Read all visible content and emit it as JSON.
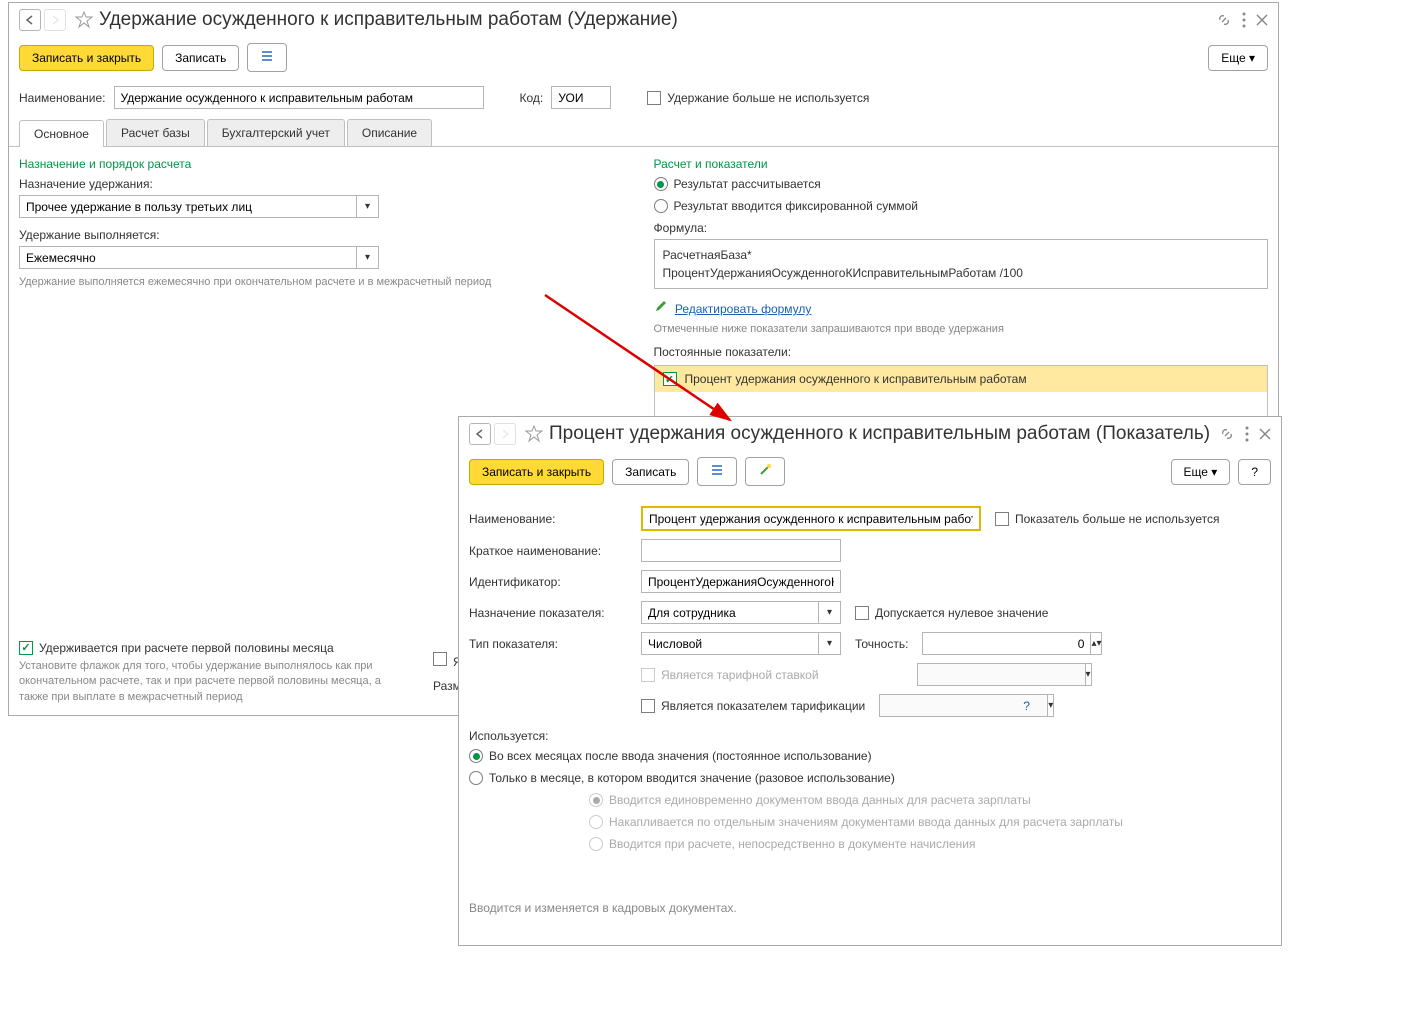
{
  "win1": {
    "title": "Удержание осужденного к исправительным работам (Удержание)",
    "save_close": "Записать и закрыть",
    "save": "Записать",
    "more": "Еще",
    "name_label": "Наименование:",
    "name_value": "Удержание осужденного к исправительным работам",
    "code_label": "Код:",
    "code_value": "УОИ",
    "not_used": "Удержание больше не используется",
    "tabs": {
      "main": "Основное",
      "base": "Расчет базы",
      "accounting": "Бухгалтерский учет",
      "description": "Описание"
    },
    "left": {
      "section1": "Назначение и порядок расчета",
      "assign_label": "Назначение удержания:",
      "assign_value": "Прочее удержание в пользу третьих лиц",
      "exec_label": "Удержание выполняется:",
      "exec_value": "Ежемесячно",
      "hint": "Удержание выполняется ежемесячно при окончательном расчете и в межрасчетный период"
    },
    "right": {
      "section2": "Расчет и показатели",
      "radio1": "Результат рассчитывается",
      "radio2": "Результат вводится фиксированной суммой",
      "formula_label": "Формула:",
      "formula1": "РасчетнаяБаза*",
      "formula2": "ПроцентУдержанияОсужденногоКИсправительнымРаботам /100",
      "edit_formula": "Редактировать формулу",
      "hint2": "Отмеченные ниже показатели запрашиваются при вводе удержания",
      "const_label": "Постоянные показатели:",
      "indicator": "Процент удержания осужденного к исправительным работам"
    },
    "footer": {
      "first_half": "Удерживается при расчете первой половины месяца",
      "note": "Установите флажок для того, чтобы удержание выполнялось как при окончательном расчете, так и при расчете первой половины месяца, а также при выплате в межрасчетный период",
      "partial1": "Является",
      "partial2": "Размер уде"
    }
  },
  "win2": {
    "title": "Процент удержания осужденного к исправительным работам (Показатель)",
    "save_close": "Записать и закрыть",
    "save": "Записать",
    "more": "Еще",
    "help": "?",
    "name_label": "Наименование:",
    "name_value": "Процент удержания осужденного к исправительным работам",
    "not_used": "Показатель больше не используется",
    "short_name_label": "Краткое наименование:",
    "short_name_value": "",
    "id_label": "Идентификатор:",
    "id_value": "ПроцентУдержанияОсужденногоК",
    "purpose_label": "Назначение показателя:",
    "purpose_value": "Для сотрудника",
    "allow_zero": "Допускается нулевое значение",
    "type_label": "Тип показателя:",
    "type_value": "Числовой",
    "precision_label": "Точность:",
    "precision_value": "0",
    "tariff_rate": "Является тарифной ставкой",
    "tariff_indicator": "Является показателем тарификации",
    "used_label": "Используется:",
    "used_opt1": "Во всех месяцах после ввода значения (постоянное использование)",
    "used_opt2": "Только в месяце, в котором вводится значение (разовое использование)",
    "sub_opt1": "Вводится единовременно документом ввода данных для расчета зарплаты",
    "sub_opt2": "Накапливается по отдельным значениям документами ввода данных для расчета зарплаты",
    "sub_opt3": "Вводится при расчете, непосредственно в документе начисления",
    "footer_note": "Вводится и изменяется в кадровых документах."
  }
}
